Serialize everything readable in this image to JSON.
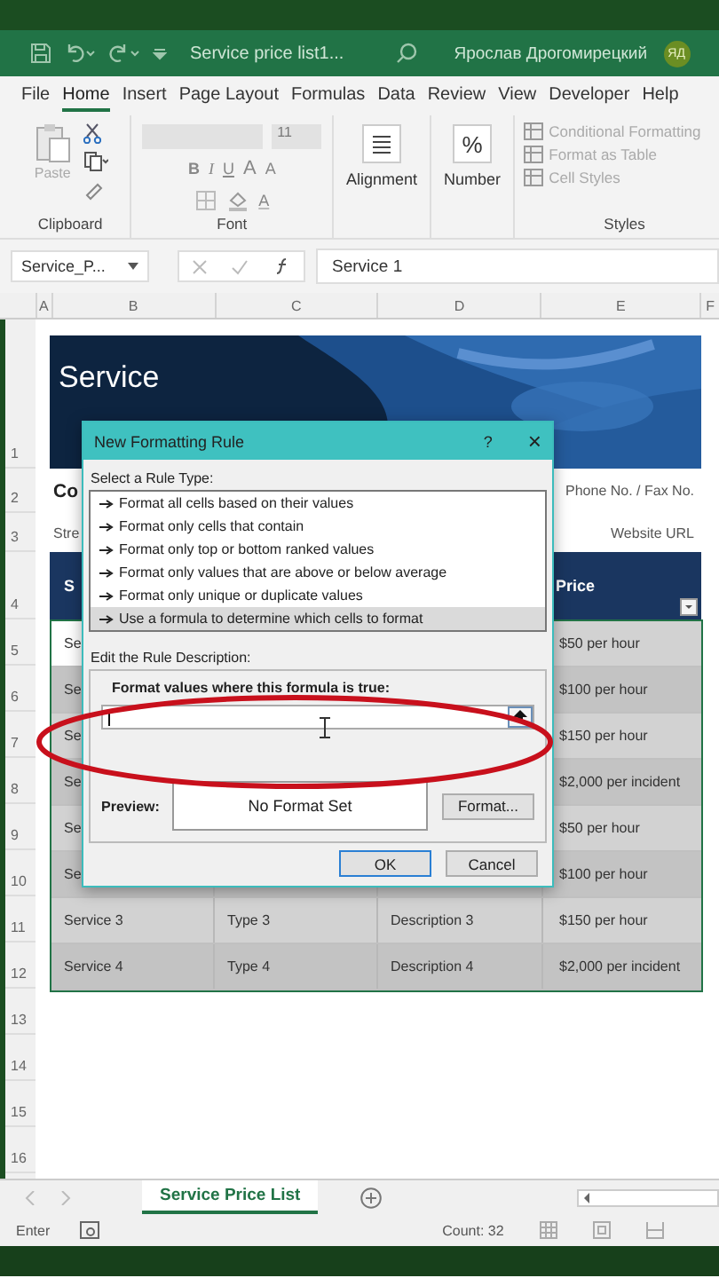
{
  "title_bar": {
    "document": "Service price list1...",
    "user": "Ярослав Дрогомирецкий",
    "avatar": "ЯД"
  },
  "menu_tabs": [
    {
      "label": "File",
      "selected": false
    },
    {
      "label": "Home",
      "selected": true
    },
    {
      "label": "Insert",
      "selected": false
    },
    {
      "label": "Page Layout",
      "selected": false
    },
    {
      "label": "Formulas",
      "selected": false
    },
    {
      "label": "Data",
      "selected": false
    },
    {
      "label": "Review",
      "selected": false
    },
    {
      "label": "View",
      "selected": false
    },
    {
      "label": "Developer",
      "selected": false
    },
    {
      "label": "Help",
      "selected": false
    }
  ],
  "ribbon": {
    "paste": "Paste",
    "clipboard_label": "Clipboard",
    "font_size": "11",
    "font_buttons": [
      "B",
      "I",
      "U"
    ],
    "size_buttons": [
      "A",
      "A"
    ],
    "font_color_button": "A",
    "font_label": "Font",
    "alignment": "Alignment",
    "number_icon": "%",
    "number": "Number",
    "styles": [
      "Conditional Formatting",
      "Format as Table",
      "Cell Styles"
    ],
    "styles_label": "Styles"
  },
  "formula_bar": {
    "name_box": "Service_P...",
    "value": "Service 1"
  },
  "columns": [
    "A",
    "B",
    "C",
    "D",
    "E",
    "F"
  ],
  "row_numbers": [
    "1",
    "2",
    "3",
    "4",
    "5",
    "6",
    "7",
    "8",
    "9",
    "10",
    "11",
    "12",
    "13",
    "14",
    "15",
    "16"
  ],
  "sheet": {
    "banner_title": "Service",
    "company": "Co",
    "street": "Stre",
    "phone": "Phone No. / Fax No.",
    "website": "Website URL",
    "header": [
      "S",
      "Price"
    ],
    "rows": [
      {
        "service": "Se",
        "price": "$50 per hour",
        "active": true
      },
      {
        "service": "Se",
        "price": "$100 per hour",
        "active": false
      },
      {
        "service": "Se",
        "price": "$150 per hour",
        "active": false
      },
      {
        "service": "Se",
        "price": "$2,000 per incident",
        "active": false
      },
      {
        "service": "Se",
        "price": "$50 per hour",
        "active": false
      },
      {
        "service": "Se",
        "price": "$100 per hour",
        "active": false
      },
      {
        "service": "Service 3",
        "type": "Type 3",
        "description": "Description 3",
        "price": "$150 per hour",
        "active": false
      },
      {
        "service": "Service 4",
        "type": "Type 4",
        "description": "Description 4",
        "price": "$2,000 per incident",
        "active": false
      }
    ]
  },
  "dialog": {
    "title": "New Formatting Rule",
    "help": "?",
    "close": "×",
    "rule_type_label": "Select a Rule Type:",
    "rule_types": [
      {
        "label": "Format all cells based on their values",
        "selected": false
      },
      {
        "label": "Format only cells that contain",
        "selected": false
      },
      {
        "label": "Format only top or bottom ranked values",
        "selected": false
      },
      {
        "label": "Format only values that are above or below average",
        "selected": false
      },
      {
        "label": "Format only unique or duplicate values",
        "selected": false
      },
      {
        "label": "Use a formula to determine which cells to format",
        "selected": true
      }
    ],
    "description_label": "Edit the Rule Description:",
    "formula_label": "Format values where this formula is true:",
    "preview_label": "Preview:",
    "preview": "No Format Set",
    "format_button": "Format...",
    "ok": "OK",
    "cancel": "Cancel"
  },
  "sheet_tabs": [
    {
      "label": "Service Price List",
      "selected": true
    }
  ],
  "status_bar": {
    "mode": "Enter",
    "count": "Count: 32"
  }
}
